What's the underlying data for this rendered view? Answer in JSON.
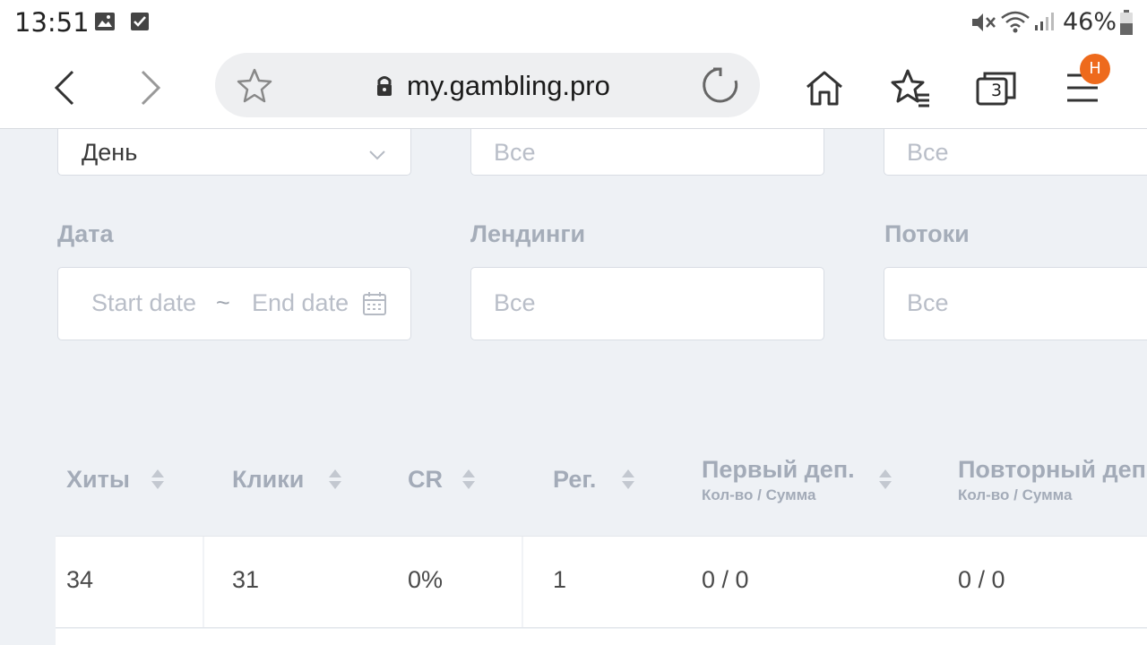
{
  "status_bar": {
    "time": "13:51",
    "battery_percent": "46%",
    "icons": [
      "image-icon",
      "checkbox-icon",
      "mute-icon",
      "wifi-icon",
      "signal-icon",
      "battery-icon"
    ]
  },
  "browser": {
    "url": "my.gambling.pro",
    "tab_count": "3",
    "menu_badge": "H"
  },
  "filters": {
    "period_value": "День",
    "top_field_2_placeholder": "Все",
    "top_field_3_placeholder": "Все",
    "date_label": "Дата",
    "start_date_placeholder": "Start date",
    "date_separator": "~",
    "end_date_placeholder": "End date",
    "landings_label": "Лендинги",
    "landings_placeholder": "Все",
    "streams_label": "Потоки",
    "streams_placeholder": "Все"
  },
  "table": {
    "columns": [
      {
        "label": "Хиты",
        "sub": ""
      },
      {
        "label": "Клики",
        "sub": ""
      },
      {
        "label": "CR",
        "sub": ""
      },
      {
        "label": "Рег.",
        "sub": ""
      },
      {
        "label": "Первый деп.",
        "sub": "Кол-во / Сумма"
      },
      {
        "label": "Повторный деп",
        "sub": "Кол-во / Сумма"
      }
    ],
    "rows": [
      [
        "34",
        "31",
        "0%",
        "1",
        "0 / 0",
        "0 / 0"
      ]
    ]
  }
}
